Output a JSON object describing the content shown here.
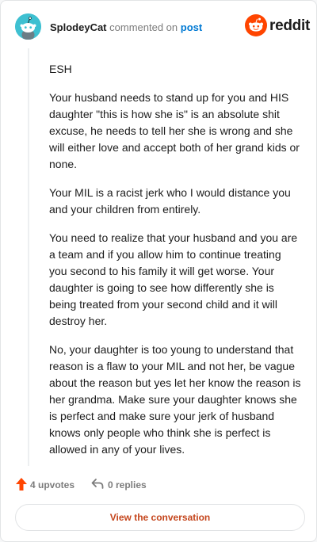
{
  "header": {
    "username": "SplodeyCat",
    "commented_on": "commented on",
    "post_link": "post",
    "brand": "reddit"
  },
  "comment": {
    "paragraphs": [
      "ESH",
      "Your husband needs to stand up for you and HIS daughter \"this is how she is\" is an absolute shit excuse, he needs to tell her she is wrong and she will either love and accept both of her grand kids or none.",
      "Your MIL is a racist jerk who I would distance you and your children from entirely.",
      "You need to realize that your husband and you are a team and if you allow him to continue treating you second to his family it will get worse. Your daughter is going to see how differently she is being treated from your second child and it will destroy her.",
      "No, your daughter is too young to understand that reason is a flaw to your MIL and not her, be vague about the reason but yes let her know the reason is her grandma. Make sure your daughter knows she is perfect and make sure your jerk of husband knows only people who think she is perfect is allowed in any of your lives."
    ]
  },
  "actions": {
    "upvotes": "4 upvotes",
    "replies": "0 replies",
    "view_conversation": "View the conversation"
  },
  "colors": {
    "brand_orange": "#ff4500",
    "cta_text": "#c4451c",
    "link_blue": "#0079d3",
    "avatar_bg": "#3ec0d1"
  },
  "icons": {
    "upvote": "upvote-arrow-icon",
    "reply": "reply-arrow-icon",
    "logo": "reddit-snoo-icon"
  }
}
